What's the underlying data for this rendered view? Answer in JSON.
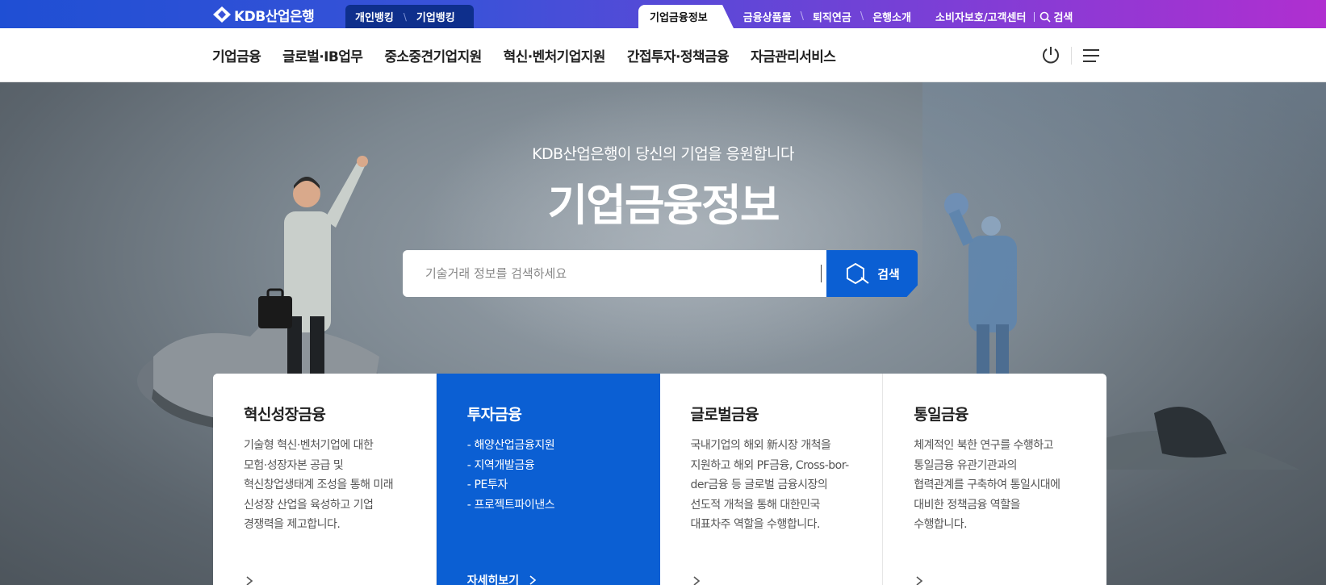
{
  "brand": {
    "logo_text": "KDB산업은행",
    "logo_icon": "kdb-logo-icon"
  },
  "bank_switch": {
    "personal": "개인뱅킹",
    "separator": "\\",
    "corporate": "기업뱅킹"
  },
  "top_nav": {
    "active_tab": "기업금융정보",
    "links": [
      "금융상품몰",
      "퇴직연금",
      "은행소개"
    ],
    "separator": "\\",
    "customer_center": "소비자보호/고객센터",
    "search_label": "검색"
  },
  "main_nav": {
    "items": [
      "기업금융",
      "글로벌·IB업무",
      "중소중견기업지원",
      "혁신·벤처기업지원",
      "간접투자·정책금융",
      "자금관리서비스"
    ],
    "icons": [
      "power-icon",
      "menu-icon"
    ]
  },
  "hero": {
    "subtitle": "KDB산업은행이 당신의 기업을 응원합니다",
    "title": "기업금융정보",
    "search_placeholder": "기술거래 정보를 검색하세요",
    "search_button": "검색"
  },
  "cards": [
    {
      "title": "혁신성장금융",
      "desc": [
        "기술형 혁신·벤처기업에 대한",
        "모험·성장자본 공급 및",
        "혁신창업생태계 조성을 통해 미래",
        "신성장 산업을 육성하고 기업",
        "경쟁력을 제고합니다."
      ]
    },
    {
      "title": "투자금융",
      "items": [
        "- 해양산업금융지원",
        "- 지역개발금융",
        "- PE투자",
        "- 프로젝트파이낸스"
      ],
      "more": "자세히보기"
    },
    {
      "title": "글로벌금융",
      "desc": [
        "국내기업의 해외 新시장 개척을",
        "지원하고 해외 PF금융, Cross-bor-",
        "der금융 등 글로벌 금융시장의",
        "선도적 개척을 통해 대한민국",
        "대표차주 역할을 수행합니다."
      ]
    },
    {
      "title": "통일금융",
      "desc": [
        "체계적인 북한 연구를 수행하고",
        "통일금융 유관기관과의",
        "협력관계를 구축하여 통일시대에",
        "대비한 정책금융 역할을",
        "수행합니다."
      ]
    }
  ]
}
